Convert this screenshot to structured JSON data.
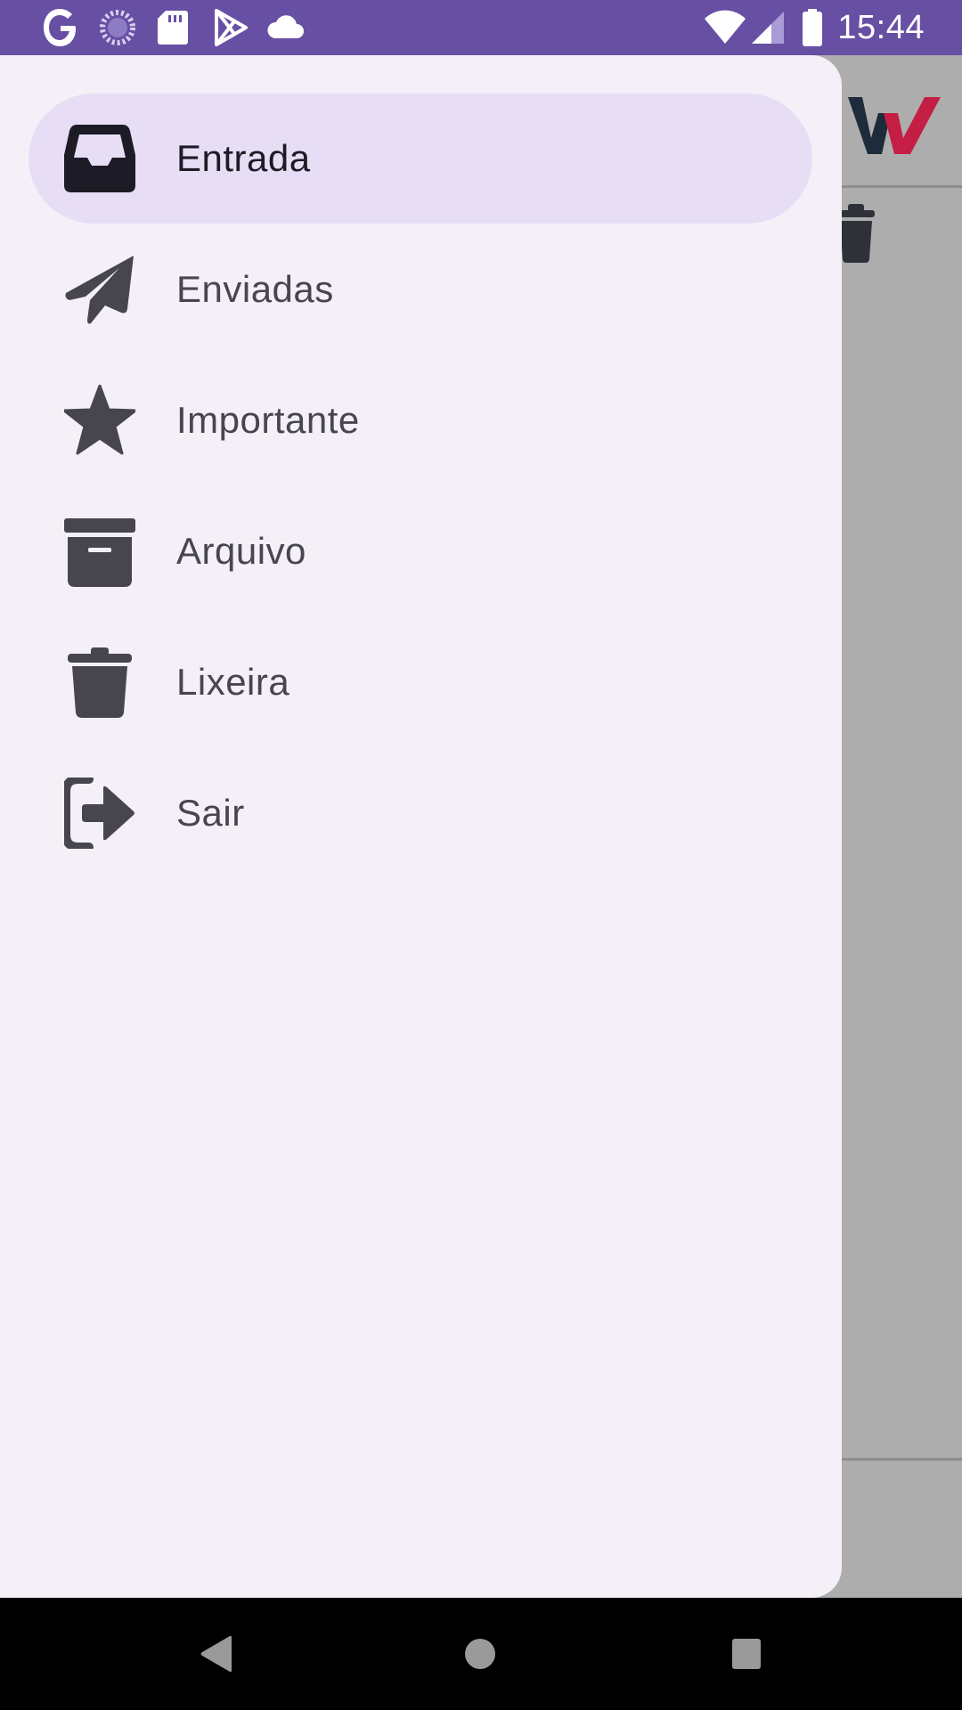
{
  "status_bar": {
    "time": "15:44",
    "background": "#6750a4",
    "left_icons": [
      "google-icon",
      "loading-icon",
      "sd-card-icon",
      "play-store-icon",
      "cloud-icon"
    ],
    "right_icons": [
      "wifi-icon",
      "signal-icon",
      "battery-icon"
    ]
  },
  "drawer": {
    "background": "#f5f0f8",
    "active_color": "#e7def6",
    "items": [
      {
        "label": "Entrada",
        "icon": "inbox-icon",
        "active": true
      },
      {
        "label": "Enviadas",
        "icon": "paper-plane-icon",
        "active": false
      },
      {
        "label": "Importante",
        "icon": "star-icon",
        "active": false
      },
      {
        "label": "Arquivo",
        "icon": "archive-icon",
        "active": false
      },
      {
        "label": "Lixeira",
        "icon": "trash-icon",
        "active": false
      },
      {
        "label": "Sair",
        "icon": "sign-out-icon",
        "active": false
      }
    ]
  },
  "background_app": {
    "logo_icon": "brand-logo-icon",
    "toolbar_icon": "trash-icon"
  },
  "navigation_bar": {
    "buttons": [
      "back-icon",
      "home-icon",
      "recents-icon"
    ]
  }
}
